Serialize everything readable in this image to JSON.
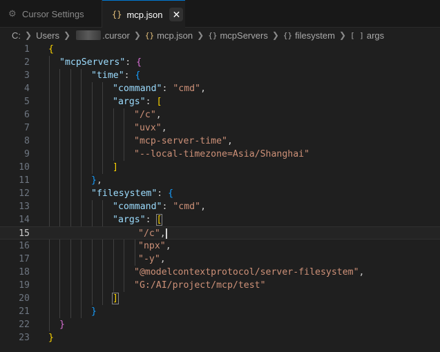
{
  "tabs": [
    {
      "label": "Cursor Settings",
      "icon": "gear-icon",
      "active": false
    },
    {
      "label": "mcp.json",
      "icon": "json-braces-icon",
      "active": true,
      "close": "✕"
    }
  ],
  "breadcrumb": {
    "drive": "C:",
    "users": "Users",
    "cursor": ".cursor",
    "file": "mcp.json",
    "key1": "mcpServers",
    "key2": "filesystem",
    "key3": "args",
    "braces": "{}",
    "brackets": "[ ]"
  },
  "editor": {
    "current_line": 15,
    "lines": [
      {
        "n": "1"
      },
      {
        "n": "2"
      },
      {
        "n": "3"
      },
      {
        "n": "4"
      },
      {
        "n": "5"
      },
      {
        "n": "6"
      },
      {
        "n": "7"
      },
      {
        "n": "8"
      },
      {
        "n": "9"
      },
      {
        "n": "10"
      },
      {
        "n": "11"
      },
      {
        "n": "12"
      },
      {
        "n": "13"
      },
      {
        "n": "14"
      },
      {
        "n": "15"
      },
      {
        "n": "16"
      },
      {
        "n": "17"
      },
      {
        "n": "18"
      },
      {
        "n": "19"
      },
      {
        "n": "20"
      },
      {
        "n": "21"
      },
      {
        "n": "22"
      },
      {
        "n": "23"
      }
    ],
    "text": {
      "k_mcpServers": "\"mcpServers\"",
      "k_time": "\"time\"",
      "k_command": "\"command\"",
      "k_args": "\"args\"",
      "k_filesystem": "\"filesystem\"",
      "s_cmd": "\"cmd\"",
      "s_c": "\"/c\"",
      "s_uvx": "\"uvx\"",
      "s_time_server": "\"mcp-server-time\"",
      "s_tz": "\"--local-timezone=Asia/Shanghai\"",
      "s_npx": "\"npx\"",
      "s_y": "\"-y\"",
      "s_fs_pkg": "\"@modelcontextprotocol/server-filesystem\"",
      "s_path": "\"G:/AI/project/mcp/test\""
    }
  },
  "colors": {
    "background": "#1f1f1f",
    "key": "#9cdcfe",
    "string": "#ce9178",
    "bracket_level1": "#ffd700",
    "bracket_level2": "#da70d6",
    "bracket_level3": "#179fff"
  }
}
